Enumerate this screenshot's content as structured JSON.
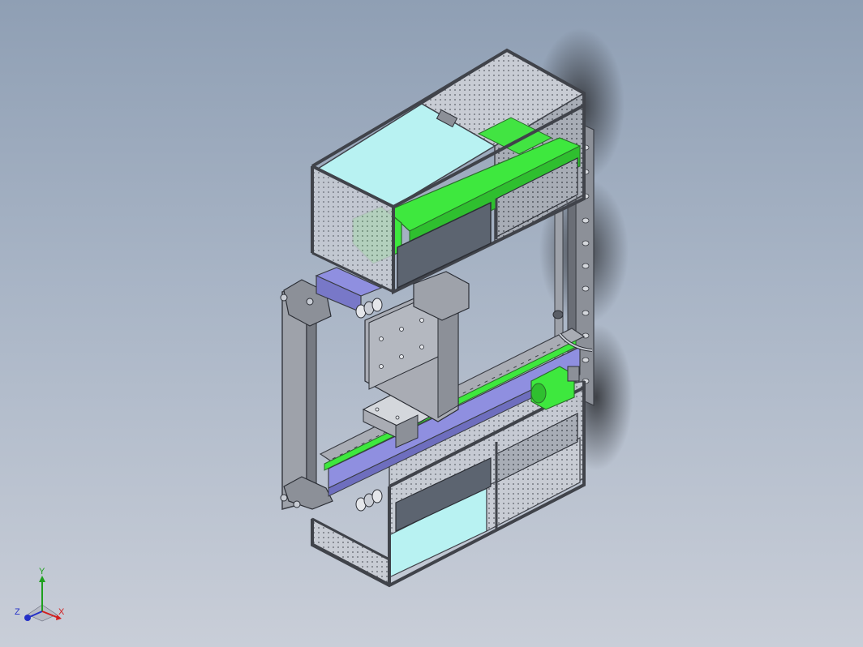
{
  "viewport": {
    "background_top": "#8f9fb4",
    "background_bottom": "#c9ced8"
  },
  "model": {
    "frame_color": "#5a5e66",
    "panel_color": "#b8f2f2",
    "dark_panel_color": "#5c6470",
    "green_color": "#3ee83e",
    "rail_color": "#8f8fe0",
    "plate_color": "#a9acb4"
  },
  "triad": {
    "y_label": "Y",
    "z_label": "Z",
    "x_label": "X",
    "y_color": "#1ea01e",
    "z_color": "#2430c8",
    "x_color": "#d21e1e"
  }
}
